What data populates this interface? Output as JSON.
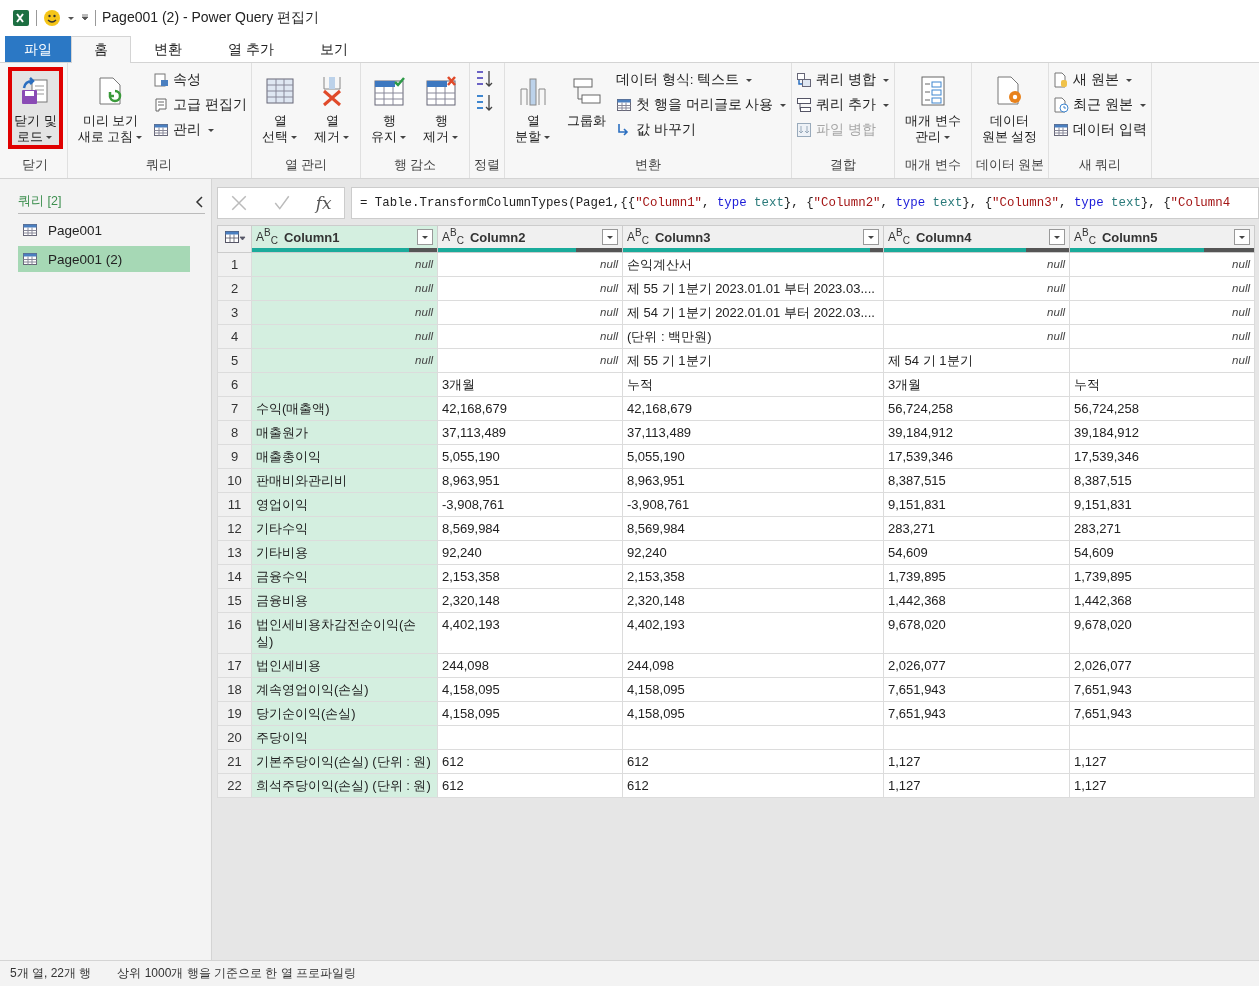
{
  "window": {
    "title": "Page001 (2) - Power Query 편집기"
  },
  "tabs": [
    {
      "label": "파일",
      "kind": "file",
      "selected": false
    },
    {
      "label": "홈",
      "kind": "tab",
      "selected": true
    },
    {
      "label": "변환",
      "kind": "tab",
      "selected": false
    },
    {
      "label": "열 추가",
      "kind": "tab",
      "selected": false
    },
    {
      "label": "보기",
      "kind": "tab",
      "selected": false
    }
  ],
  "ribbon": {
    "groups": [
      {
        "label": "닫기",
        "columns": [
          {
            "kind": "large",
            "lines": [
              "닫기 및",
              "로드"
            ],
            "dropdown": true,
            "highlighted": true
          }
        ]
      },
      {
        "label": "쿼리",
        "columns": [
          {
            "kind": "large",
            "lines": [
              "미리 보기",
              "새로 고침"
            ],
            "dropdown": true,
            "highlighted": false
          },
          {
            "kind": "stack",
            "items": [
              {
                "label": "속성",
                "dropdown": false,
                "disabled": false
              },
              {
                "label": "고급 편집기",
                "dropdown": false,
                "disabled": false
              },
              {
                "label": "관리",
                "dropdown": true,
                "disabled": false
              }
            ]
          }
        ]
      },
      {
        "label": "열 관리",
        "columns": [
          {
            "kind": "large",
            "lines": [
              "열",
              "선택"
            ],
            "dropdown": true,
            "highlighted": false
          },
          {
            "kind": "large",
            "lines": [
              "열",
              "제거"
            ],
            "dropdown": true,
            "highlighted": false
          }
        ]
      },
      {
        "label": "행 감소",
        "columns": [
          {
            "kind": "large",
            "lines": [
              "행",
              "유지"
            ],
            "dropdown": true,
            "highlighted": false
          },
          {
            "kind": "large",
            "lines": [
              "행",
              "제거"
            ],
            "dropdown": true,
            "highlighted": false
          }
        ]
      },
      {
        "label": "정렬",
        "columns": [
          {
            "kind": "sort"
          }
        ]
      },
      {
        "label": "변환",
        "columns": [
          {
            "kind": "large",
            "lines": [
              "열",
              "분할"
            ],
            "dropdown": true,
            "highlighted": false
          },
          {
            "kind": "large",
            "lines": [
              "그룹화"
            ],
            "dropdown": false,
            "highlighted": false
          },
          {
            "kind": "stack",
            "items": [
              {
                "label": "데이터 형식: 텍스트",
                "dropdown": true,
                "disabled": false
              },
              {
                "label": "첫 행을 머리글로 사용",
                "dropdown": true,
                "disabled": false
              },
              {
                "label": "값 바꾸기",
                "dropdown": false,
                "disabled": false
              }
            ]
          }
        ]
      },
      {
        "label": "결합",
        "columns": [
          {
            "kind": "stack",
            "items": [
              {
                "label": "쿼리 병합",
                "dropdown": true,
                "disabled": false
              },
              {
                "label": "쿼리 추가",
                "dropdown": true,
                "disabled": false
              },
              {
                "label": "파일 병합",
                "dropdown": false,
                "disabled": true
              }
            ]
          }
        ]
      },
      {
        "label": "매개 변수",
        "columns": [
          {
            "kind": "large",
            "lines": [
              "매개 변수",
              "관리"
            ],
            "dropdown": true,
            "highlighted": false
          }
        ]
      },
      {
        "label": "데이터 원본",
        "columns": [
          {
            "kind": "large",
            "lines": [
              "데이터",
              "원본 설정"
            ],
            "dropdown": false,
            "highlighted": false
          }
        ]
      },
      {
        "label": "새 쿼리",
        "columns": [
          {
            "kind": "stack",
            "items": [
              {
                "label": "새 원본",
                "dropdown": true,
                "disabled": false
              },
              {
                "label": "최근 원본",
                "dropdown": true,
                "disabled": false
              },
              {
                "label": "데이터 입력",
                "dropdown": false,
                "disabled": false
              }
            ]
          }
        ]
      }
    ]
  },
  "queries": {
    "title": "쿼리 [2]",
    "items": [
      {
        "label": "Page001",
        "selected": false
      },
      {
        "label": "Page001 (2)",
        "selected": true
      }
    ]
  },
  "formula_bar": {
    "fx": "fx",
    "tokens": [
      {
        "t": "= Table.TransformColumnTypes(Page1,{{",
        "kind": "plain"
      },
      {
        "t": "\"Column1\"",
        "kind": "str"
      },
      {
        "t": ", ",
        "kind": "plain"
      },
      {
        "t": "type",
        "kind": "kw"
      },
      {
        "t": " text",
        "kind": "type"
      },
      {
        "t": "}, {",
        "kind": "plain"
      },
      {
        "t": "\"Column2\"",
        "kind": "str"
      },
      {
        "t": ", ",
        "kind": "plain"
      },
      {
        "t": "type",
        "kind": "kw"
      },
      {
        "t": " text",
        "kind": "type"
      },
      {
        "t": "}, {",
        "kind": "plain"
      },
      {
        "t": "\"Column3\"",
        "kind": "str"
      },
      {
        "t": ", ",
        "kind": "plain"
      },
      {
        "t": "type",
        "kind": "kw"
      },
      {
        "t": " text",
        "kind": "type"
      },
      {
        "t": "}, {",
        "kind": "plain"
      },
      {
        "t": "\"Column4",
        "kind": "str"
      }
    ]
  },
  "table": {
    "columns": [
      {
        "name": "Column1",
        "type": "A$^{B}$$_{C}$",
        "selected": true,
        "level": 0.85
      },
      {
        "name": "Column2",
        "type": "A$^{B}$$_{C}$",
        "selected": false,
        "level": 0.75
      },
      {
        "name": "Column3",
        "type": "A$^{B}$$_{C}$",
        "selected": false,
        "level": 0.95
      },
      {
        "name": "Column4",
        "type": "A$^{B}$$_{C}$",
        "selected": false,
        "level": 0.77
      },
      {
        "name": "Column5",
        "type": "A$^{B}$$_{C}$",
        "selected": false,
        "level": 0.73
      }
    ],
    "rows": [
      {
        "n": "1",
        "cells": [
          {
            "text": "null",
            "null": true
          },
          {
            "text": "null",
            "null": true
          },
          {
            "text": "손익계산서",
            "null": false
          },
          {
            "text": "null",
            "null": true
          },
          {
            "text": "null",
            "null": true
          }
        ]
      },
      {
        "n": "2",
        "cells": [
          {
            "text": "null",
            "null": true
          },
          {
            "text": "null",
            "null": true
          },
          {
            "text": "제 55 기 1분기 2023.01.01 부터 2023.03....",
            "null": false
          },
          {
            "text": "null",
            "null": true
          },
          {
            "text": "null",
            "null": true
          }
        ]
      },
      {
        "n": "3",
        "cells": [
          {
            "text": "null",
            "null": true
          },
          {
            "text": "null",
            "null": true
          },
          {
            "text": "제 54 기 1분기 2022.01.01 부터 2022.03....",
            "null": false
          },
          {
            "text": "null",
            "null": true
          },
          {
            "text": "null",
            "null": true
          }
        ]
      },
      {
        "n": "4",
        "cells": [
          {
            "text": "null",
            "null": true
          },
          {
            "text": "null",
            "null": true
          },
          {
            "text": "(단위 : 백만원)",
            "null": false
          },
          {
            "text": "null",
            "null": true
          },
          {
            "text": "null",
            "null": true
          }
        ]
      },
      {
        "n": "5",
        "cells": [
          {
            "text": "null",
            "null": true
          },
          {
            "text": "null",
            "null": true
          },
          {
            "text": "제 55 기 1분기",
            "null": false
          },
          {
            "text": "제 54 기 1분기",
            "null": false
          },
          {
            "text": "null",
            "null": true
          }
        ]
      },
      {
        "n": "6",
        "cells": [
          {
            "null": false
          },
          {
            "text": "3개월",
            "null": false
          },
          {
            "text": "누적",
            "null": false
          },
          {
            "text": "3개월",
            "null": false
          },
          {
            "text": "누적",
            "null": false
          }
        ]
      },
      {
        "n": "7",
        "cells": [
          {
            "text": "수익(매출액)",
            "null": false
          },
          {
            "text": "42,168,679",
            "null": false
          },
          {
            "text": "42,168,679",
            "null": false
          },
          {
            "text": "56,724,258",
            "null": false
          },
          {
            "text": "56,724,258",
            "null": false
          }
        ]
      },
      {
        "n": "8",
        "cells": [
          {
            "text": "매출원가",
            "null": false
          },
          {
            "text": "37,113,489",
            "null": false
          },
          {
            "text": "37,113,489",
            "null": false
          },
          {
            "text": "39,184,912",
            "null": false
          },
          {
            "text": "39,184,912",
            "null": false
          }
        ]
      },
      {
        "n": "9",
        "cells": [
          {
            "text": "매출총이익",
            "null": false
          },
          {
            "text": "5,055,190",
            "null": false
          },
          {
            "text": "5,055,190",
            "null": false
          },
          {
            "text": "17,539,346",
            "null": false
          },
          {
            "text": "17,539,346",
            "null": false
          }
        ]
      },
      {
        "n": "10",
        "cells": [
          {
            "text": "판매비와관리비",
            "null": false
          },
          {
            "text": "8,963,951",
            "null": false
          },
          {
            "text": "8,963,951",
            "null": false
          },
          {
            "text": "8,387,515",
            "null": false
          },
          {
            "text": "8,387,515",
            "null": false
          }
        ]
      },
      {
        "n": "11",
        "cells": [
          {
            "text": "영업이익",
            "null": false
          },
          {
            "text": "-3,908,761",
            "null": false
          },
          {
            "text": "-3,908,761",
            "null": false
          },
          {
            "text": "9,151,831",
            "null": false
          },
          {
            "text": "9,151,831",
            "null": false
          }
        ]
      },
      {
        "n": "12",
        "cells": [
          {
            "text": "기타수익",
            "null": false
          },
          {
            "text": "8,569,984",
            "null": false
          },
          {
            "text": "8,569,984",
            "null": false
          },
          {
            "text": "283,271",
            "null": false
          },
          {
            "text": "283,271",
            "null": false
          }
        ]
      },
      {
        "n": "13",
        "cells": [
          {
            "text": "기타비용",
            "null": false
          },
          {
            "text": "92,240",
            "null": false
          },
          {
            "text": "92,240",
            "null": false
          },
          {
            "text": "54,609",
            "null": false
          },
          {
            "text": "54,609",
            "null": false
          }
        ]
      },
      {
        "n": "14",
        "cells": [
          {
            "text": "금융수익",
            "null": false
          },
          {
            "text": "2,153,358",
            "null": false
          },
          {
            "text": "2,153,358",
            "null": false
          },
          {
            "text": "1,739,895",
            "null": false
          },
          {
            "text": "1,739,895",
            "null": false
          }
        ]
      },
      {
        "n": "15",
        "cells": [
          {
            "text": "금융비용",
            "null": false
          },
          {
            "text": "2,320,148",
            "null": false
          },
          {
            "text": "2,320,148",
            "null": false
          },
          {
            "text": "1,442,368",
            "null": false
          },
          {
            "text": "1,442,368",
            "null": false
          }
        ]
      },
      {
        "n": "16",
        "cells": [
          {
            "text": "법인세비용차감전순이익(손실)",
            "null": false
          },
          {
            "text": "4,402,193",
            "null": false
          },
          {
            "text": "4,402,193",
            "null": false
          },
          {
            "text": "9,678,020",
            "null": false
          },
          {
            "text": "9,678,020",
            "null": false
          }
        ]
      },
      {
        "n": "17",
        "cells": [
          {
            "text": "법인세비용",
            "null": false
          },
          {
            "text": "244,098",
            "null": false
          },
          {
            "text": "244,098",
            "null": false
          },
          {
            "text": "2,026,077",
            "null": false
          },
          {
            "text": "2,026,077",
            "null": false
          }
        ]
      },
      {
        "n": "18",
        "cells": [
          {
            "text": "계속영업이익(손실)",
            "null": false
          },
          {
            "text": "4,158,095",
            "null": false
          },
          {
            "text": "4,158,095",
            "null": false
          },
          {
            "text": "7,651,943",
            "null": false
          },
          {
            "text": "7,651,943",
            "null": false
          }
        ]
      },
      {
        "n": "19",
        "cells": [
          {
            "text": "당기순이익(손실)",
            "null": false
          },
          {
            "text": "4,158,095",
            "null": false
          },
          {
            "text": "4,158,095",
            "null": false
          },
          {
            "text": "7,651,943",
            "null": false
          },
          {
            "text": "7,651,943",
            "null": false
          }
        ]
      },
      {
        "n": "20",
        "cells": [
          {
            "text": "주당이익",
            "null": false
          },
          {
            "null": false
          },
          {
            "null": false
          },
          {
            "null": false
          },
          {
            "null": false
          }
        ]
      },
      {
        "n": "21",
        "cells": [
          {
            "text": "기본주당이익(손실) (단위 : 원)",
            "null": false
          },
          {
            "text": "612",
            "null": false
          },
          {
            "text": "612",
            "null": false
          },
          {
            "text": "1,127",
            "null": false
          },
          {
            "text": "1,127",
            "null": false
          }
        ]
      },
      {
        "n": "22",
        "cells": [
          {
            "text": "희석주당이익(손실) (단위 : 원)",
            "null": false
          },
          {
            "text": "612",
            "null": false
          },
          {
            "text": "612",
            "null": false
          },
          {
            "text": "1,127",
            "null": false
          },
          {
            "text": "1,127",
            "null": false
          }
        ]
      }
    ]
  },
  "status_bar": {
    "left": "5개 열, 22개 행",
    "right": "상위 1000개 행을 기준으로 한 열 프로파일링"
  }
}
